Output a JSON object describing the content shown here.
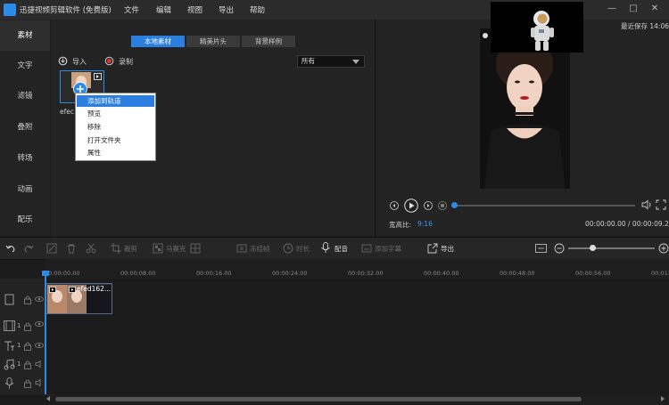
{
  "app": {
    "title": "迅捷视频剪辑软件 (免费版)"
  },
  "menu": [
    "文件",
    "编辑",
    "视图",
    "导出",
    "帮助"
  ],
  "save_status": "最近保存 14:06",
  "left_tabs": [
    "素材",
    "文字",
    "滤镜",
    "叠附",
    "转场",
    "动画",
    "配乐"
  ],
  "media": {
    "subtabs": [
      "本地素材",
      "精美片头",
      "背景样例"
    ],
    "import_label": "导入",
    "record_label": "录制",
    "sort_select": "所有",
    "clip_name": "efec"
  },
  "context_menu": [
    "添加到轨道",
    "预览",
    "移除",
    "打开文件夹",
    "属性"
  ],
  "preview": {
    "aspect_label": "宽高比:",
    "aspect_value": "9:16",
    "time_current": "00:00:00.00",
    "time_total": "00:00:09.26"
  },
  "toolbar": {
    "crop": "裁剪",
    "mosaic": "马赛克",
    "freeze": "冻结帧",
    "duration": "时长",
    "dub": "配音",
    "subtitle": "添加字幕",
    "export": "导出"
  },
  "ruler_ticks": [
    "00:00:00.00",
    "00:00:08.00",
    "00:00:16.00",
    "00:00:24.00",
    "00:00:32.00",
    "00:00:40.00",
    "00:00:48.00",
    "00:00:56.00",
    "00:01:0"
  ],
  "timeline_clip": {
    "label": "efed162..."
  },
  "track_number": "1"
}
